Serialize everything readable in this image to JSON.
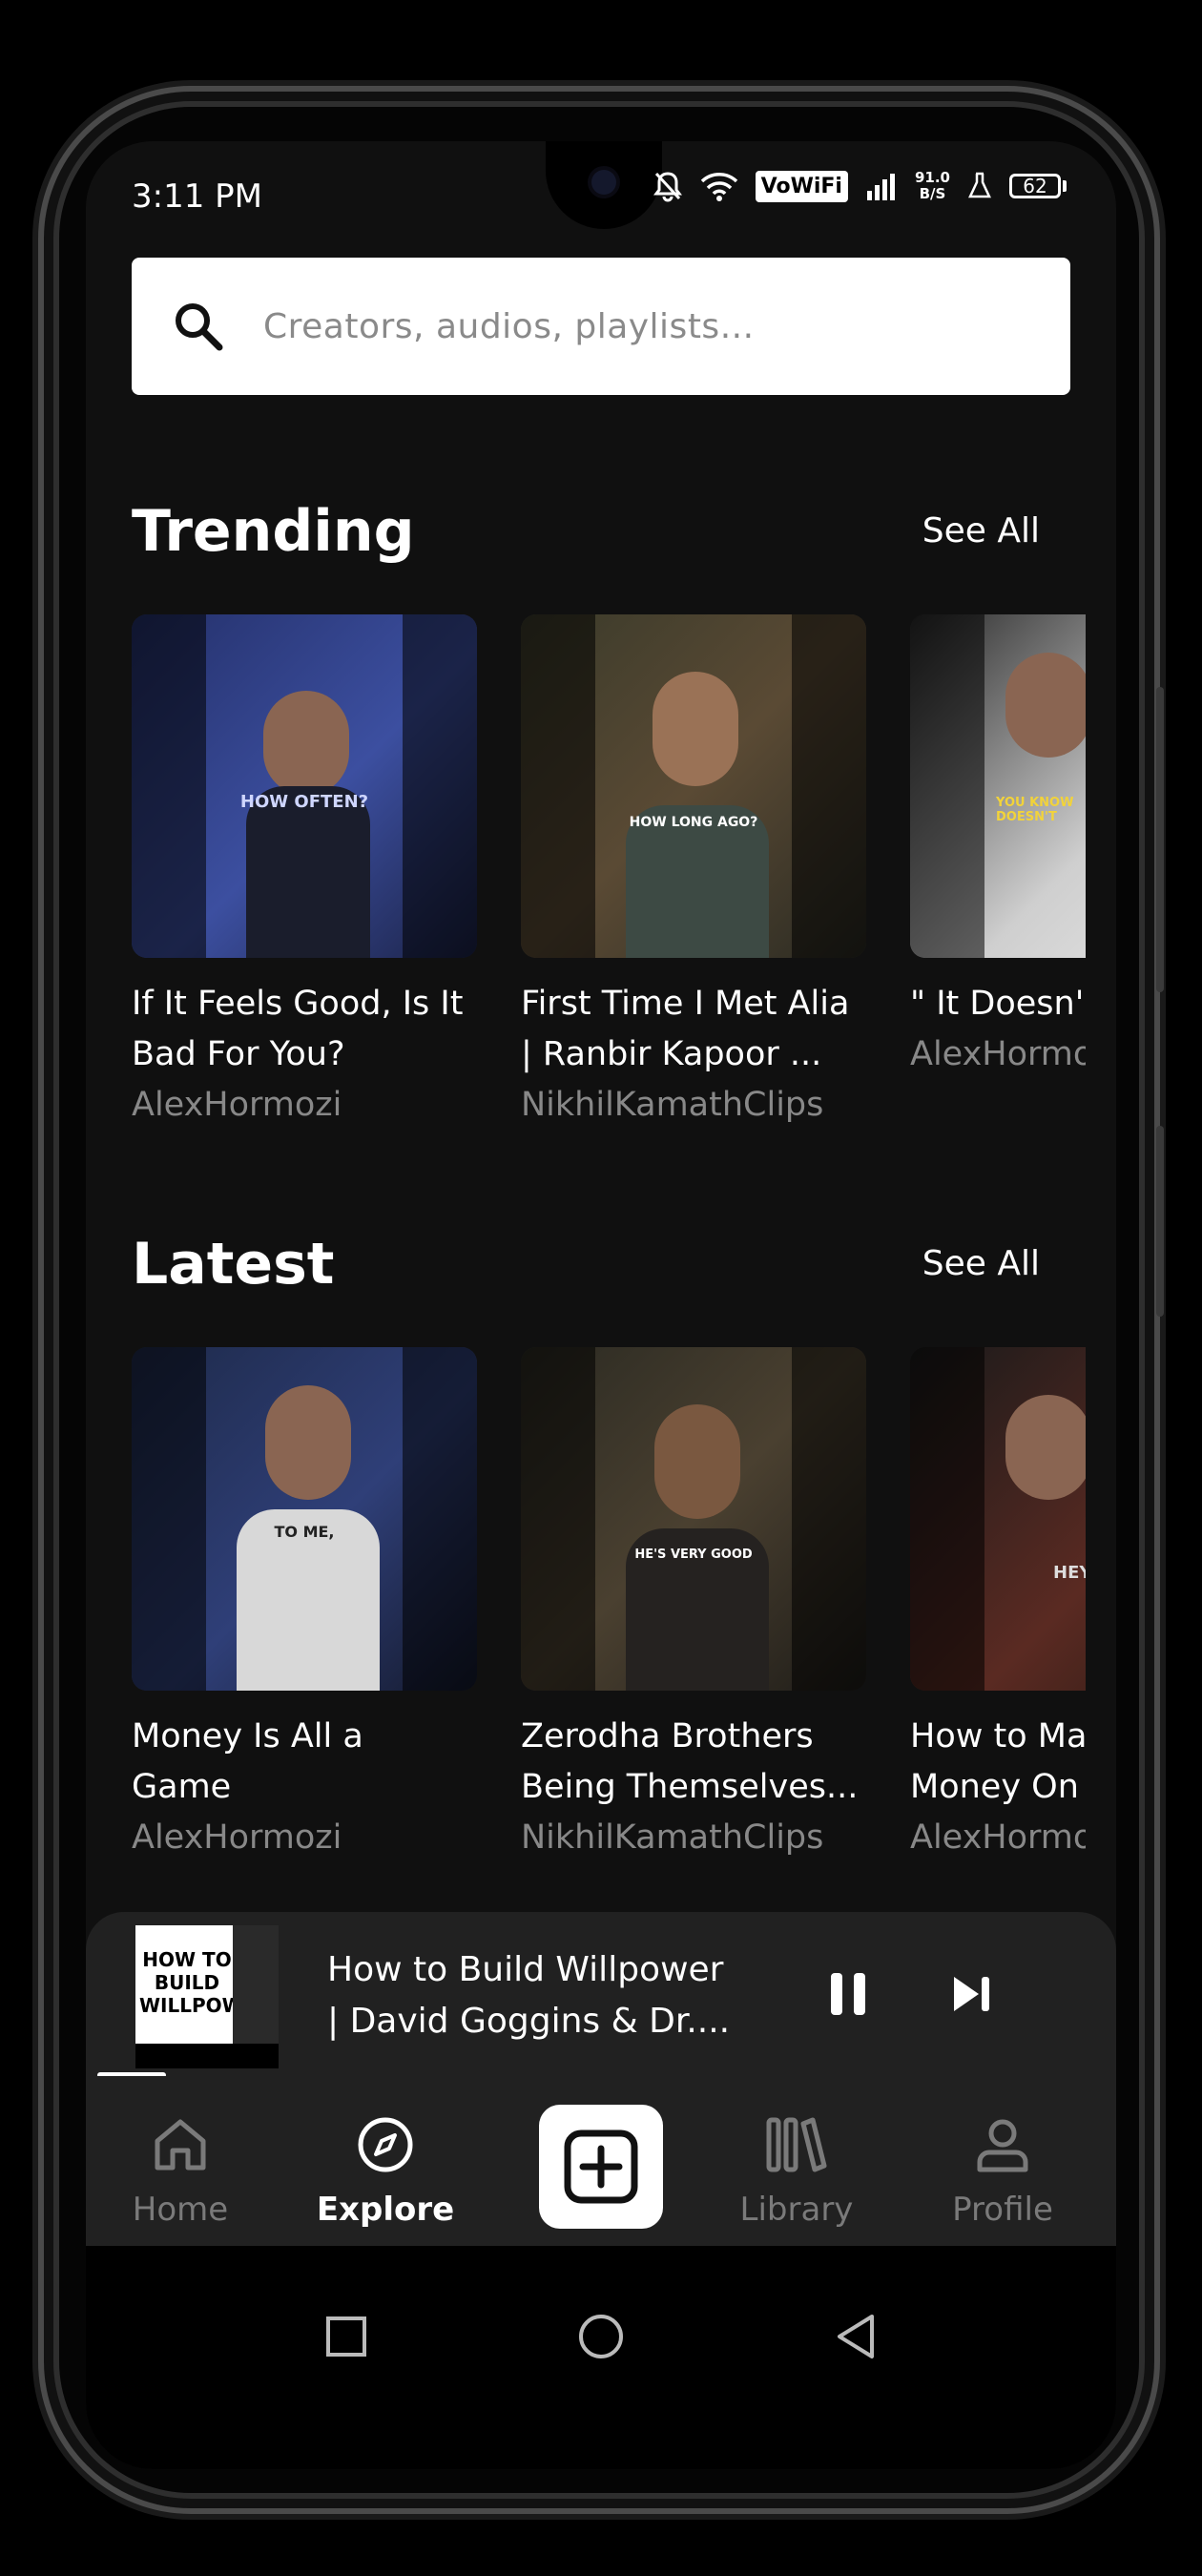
{
  "status_bar": {
    "time": "3:11 PM",
    "wifi_label": "VoWiFi",
    "speed_value": "91.0",
    "speed_unit": "B/S",
    "battery": "62"
  },
  "search": {
    "placeholder": "Creators, audios, playlists..."
  },
  "trending": {
    "title": "Trending",
    "see_all": "See All",
    "items": [
      {
        "title_line1": "If It Feels Good, Is It",
        "title_line2": "Bad For You?",
        "author": "AlexHormozi",
        "thumb_caption": "HOW OFTEN?"
      },
      {
        "title_line1": "First Time I Met Alia",
        "title_line2": "| Ranbir Kapoor ...",
        "author": "NikhilKamathClips",
        "thumb_caption": "HOW LONG AGO?"
      },
      {
        "title_line1": "\" It Doesn'",
        "title_line2": "",
        "author": "AlexHormo",
        "thumb_caption": "YOU KNOW DOESN'T"
      }
    ]
  },
  "latest": {
    "title": "Latest",
    "see_all": "See All",
    "items": [
      {
        "title_line1": "Money Is All a",
        "title_line2": "Game",
        "author": "AlexHormozi",
        "thumb_caption": "TO ME,"
      },
      {
        "title_line1": "Zerodha Brothers",
        "title_line2": "Being Themselves...",
        "author": "NikhilKamathClips",
        "thumb_caption": "HE'S VERY GOOD"
      },
      {
        "title_line1": "How to Ma",
        "title_line2": "Money On",
        "author": "AlexHormo",
        "thumb_caption": "HEY"
      }
    ]
  },
  "now_playing": {
    "title_line1": "How to Build Willpower",
    "title_line2": "| David Goggins & Dr....",
    "art_text": "HOW TO BUILD WILLPOWER",
    "progress": 0.07
  },
  "nav": {
    "home": "Home",
    "explore": "Explore",
    "library": "Library",
    "profile": "Profile",
    "active": "explore"
  },
  "colors": {
    "background": "#101010",
    "panel": "#212121",
    "muted": "#888888",
    "accent": "#ffffff"
  }
}
